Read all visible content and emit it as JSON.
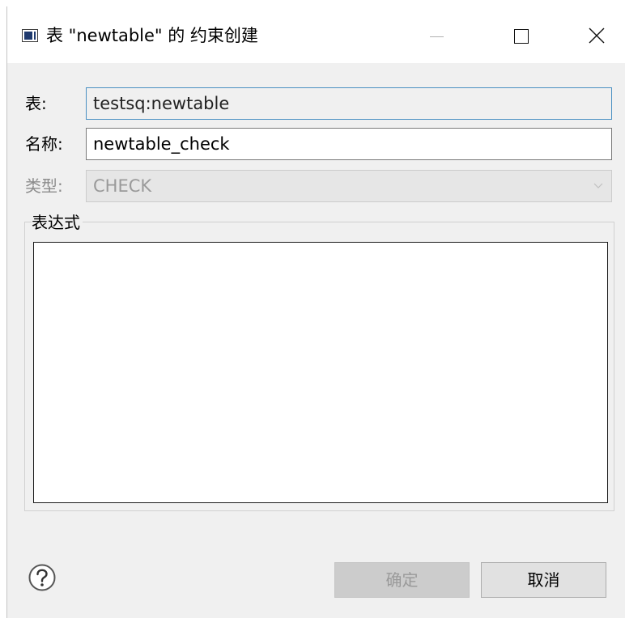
{
  "window": {
    "title": "表 \"newtable\" 的 约束创建",
    "icon": "app-window-icon",
    "controls": {
      "minimize_icon": "minimize-icon",
      "maximize_icon": "maximize-icon",
      "close_icon": "close-icon"
    }
  },
  "form": {
    "table": {
      "label": "表:",
      "value": "testsq:newtable"
    },
    "name": {
      "label": "名称:",
      "value": "newtable_check"
    },
    "type": {
      "label": "类型:",
      "selected": "CHECK",
      "enabled": false
    }
  },
  "expression": {
    "legend": "表达式",
    "value": ""
  },
  "footer": {
    "help_icon": "help-icon",
    "ok_label": "确定",
    "ok_enabled": false,
    "cancel_label": "取消"
  },
  "colors": {
    "dialog_bg": "#f0f0f0",
    "focus_border": "#4a90c2",
    "disabled_text": "#9a9a9a"
  }
}
